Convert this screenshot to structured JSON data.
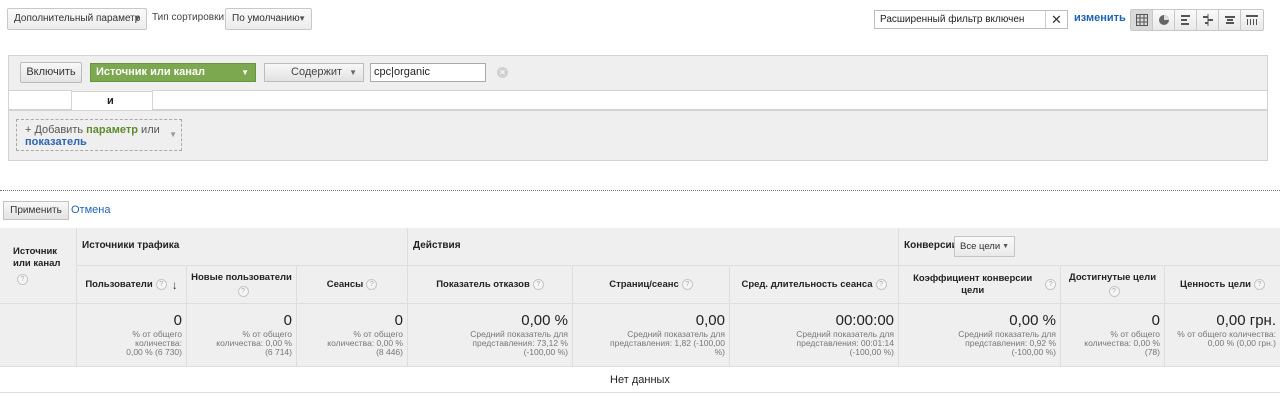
{
  "toolbar": {
    "secondary_dimension": "Дополнительный параметр",
    "sort_type_label": "Тип сортировки:",
    "sort_type_value": "По умолчанию",
    "filter_status": "Расширенный фильтр включен",
    "change_link": "изменить",
    "views": [
      "table-icon",
      "pie-icon",
      "bar-icon",
      "comparison-icon",
      "term-cloud-icon",
      "pivot-icon"
    ]
  },
  "filter": {
    "include_label": "Включить",
    "dimension": "Источник или канал",
    "match_type": "Содержит",
    "value": "cpc|organic",
    "and_label": "и",
    "add_prefix": "+ Добавить",
    "add_param": "параметр",
    "add_or": "или",
    "add_metric": "показатель"
  },
  "actions": {
    "apply": "Применить",
    "cancel": "Отмена"
  },
  "table": {
    "dim_header": "Источник или канал",
    "groups": {
      "acquisition": "Источники трафика",
      "behavior": "Действия",
      "conversions": "Конверсии",
      "goals_option": "Все цели"
    },
    "columns": [
      {
        "label": "Пользователи",
        "value": "0",
        "sub": "% от общего количества: 0,00 % (6 730)"
      },
      {
        "label": "Новые пользователи",
        "value": "0",
        "sub": "% от общего количества: 0,00 % (6 714)"
      },
      {
        "label": "Сеансы",
        "value": "0",
        "sub": "% от общего количества: 0,00 % (8 446)"
      },
      {
        "label": "Показатель отказов",
        "value": "0,00 %",
        "sub": "Средний показатель для представления: 73,12 % (-100,00 %)"
      },
      {
        "label": "Страниц/сеанс",
        "value": "0,00",
        "sub": "Средний показатель для представления: 1,82 (-100,00 %)"
      },
      {
        "label": "Сред. длительность сеанса",
        "value": "00:00:00",
        "sub": "Средний показатель для представления: 00:01:14 (-100,00 %)"
      },
      {
        "label": "Коэффициент конверсии цели",
        "value": "0,00 %",
        "sub": "Средний показатель для представления: 0,92 % (-100,00 %)"
      },
      {
        "label": "Достигнутые цели",
        "value": "0",
        "sub": "% от общего количества: 0,00 % (78)"
      },
      {
        "label": "Ценность цели",
        "value": "0,00 грн.",
        "sub": "% от общего количества: 0,00 % (0,00 грн.)"
      }
    ],
    "no_data": "Нет данных"
  }
}
